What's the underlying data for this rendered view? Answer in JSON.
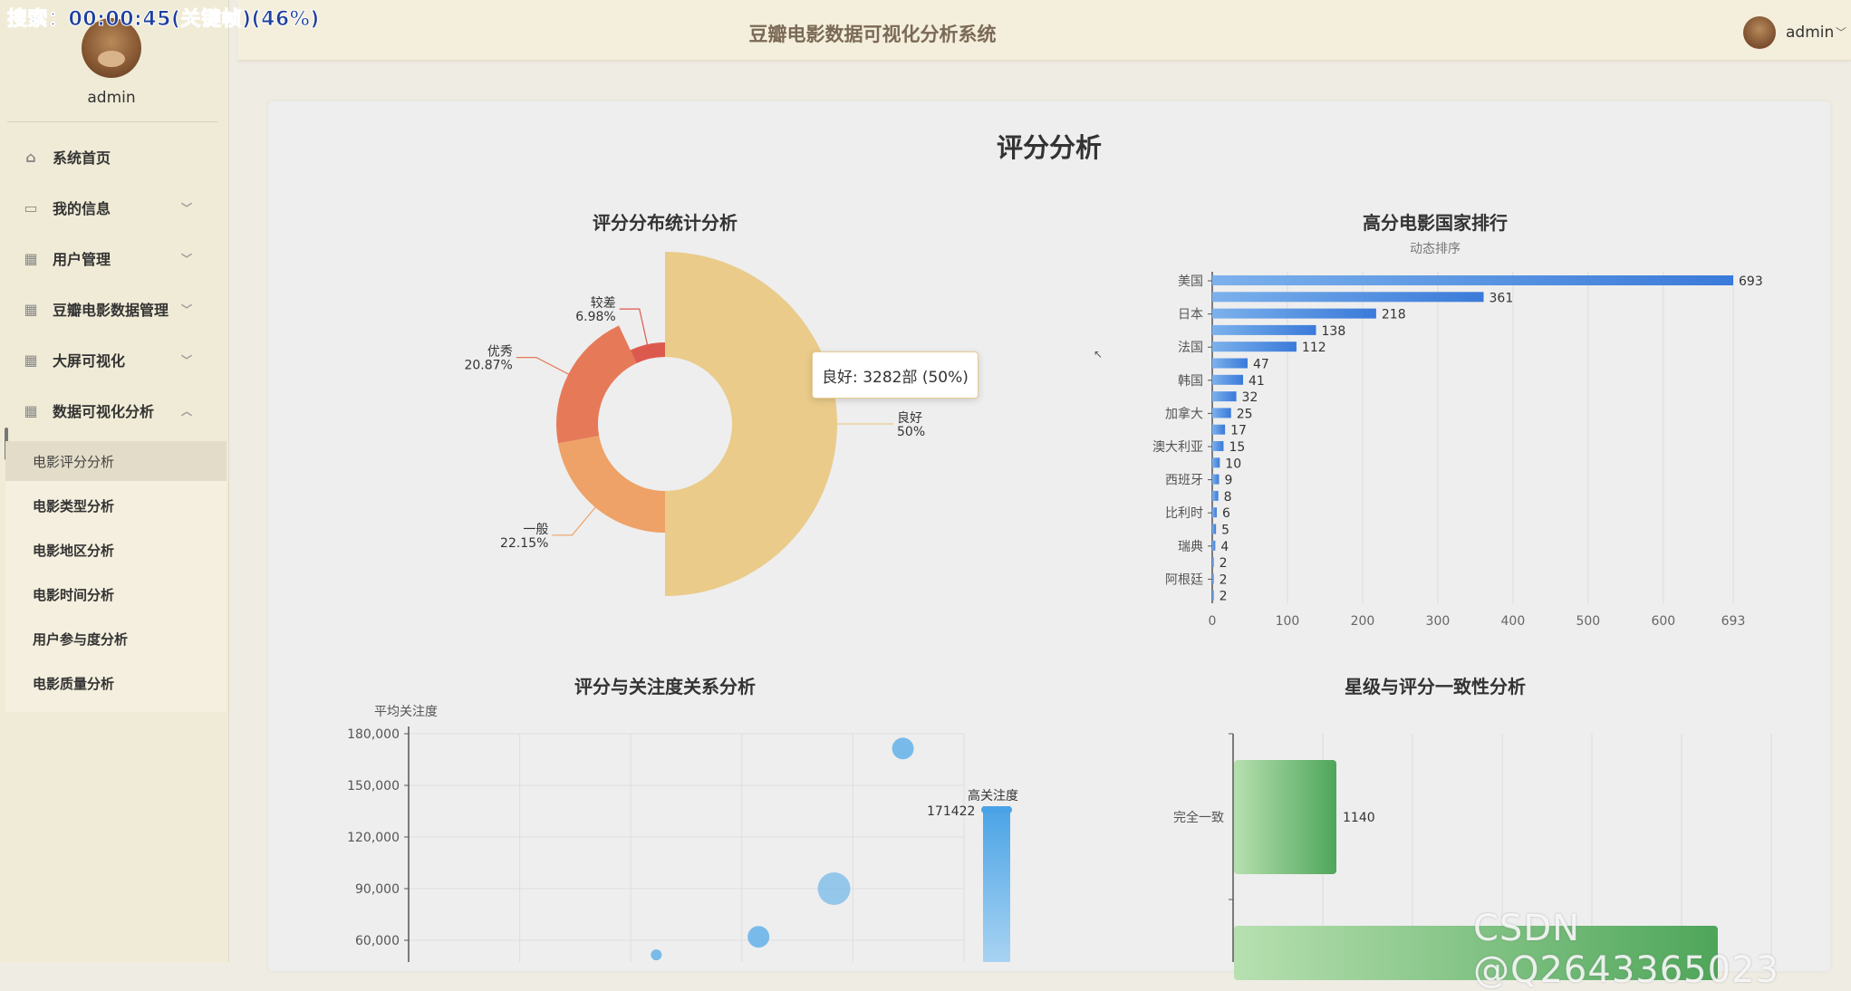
{
  "overlay": {
    "text": "搜索：00:00:45(关键帧)(46%)"
  },
  "header": {
    "title": "豆瓣电影数据可视化分析系统",
    "username": "admin"
  },
  "sidebar": {
    "username": "admin",
    "menu": [
      {
        "label": "系统首页",
        "icon": "home-icon"
      },
      {
        "label": "我的信息",
        "icon": "card-icon"
      },
      {
        "label": "用户管理",
        "icon": "grid-icon"
      },
      {
        "label": "豆瓣电影数据管理",
        "icon": "grid-icon"
      },
      {
        "label": "大屏可视化",
        "icon": "grid-icon"
      },
      {
        "label": "数据可视化分析",
        "icon": "grid-icon"
      }
    ],
    "submenu": [
      "电影评分分析",
      "电影类型分析",
      "电影地区分析",
      "电影时间分析",
      "用户参与度分析",
      "电影质量分析"
    ]
  },
  "page": {
    "title": "评分分析"
  },
  "charts": {
    "pie": {
      "title": "评分分布统计分析",
      "tooltip": "良好: 3282部 (50%)"
    },
    "bar": {
      "title": "高分电影国家排行",
      "subtitle": "动态排序"
    },
    "scatter": {
      "title": "评分与关注度关系分析",
      "y_axis_name": "平均关注度",
      "visual_map_label": "高关注度",
      "visual_map_max": "171422"
    },
    "hbar": {
      "title": "星级与评分一致性分析"
    }
  },
  "watermark": "CSDN @Q2643365023",
  "chart_data": [
    {
      "type": "pie",
      "title": "评分分布统计分析",
      "slices": [
        {
          "name": "良好",
          "label": "50%",
          "value": 50,
          "color": "#eacb8a"
        },
        {
          "name": "一般",
          "label": "22.15%",
          "value": 22.15,
          "color": "#eea267"
        },
        {
          "name": "优秀",
          "label": "20.87%",
          "value": 20.87,
          "color": "#e67a58"
        },
        {
          "name": "较差",
          "label": "6.98%",
          "value": 6.98,
          "color": "#dc5a4d"
        }
      ]
    },
    {
      "type": "bar",
      "title": "高分电影国家排行",
      "subtitle": "动态排序",
      "values": [
        693,
        361,
        218,
        138,
        112,
        47,
        41,
        32,
        25,
        17,
        15,
        10,
        9,
        8,
        6,
        5,
        4,
        2,
        2,
        2
      ],
      "category_labels": [
        "美国",
        "日本",
        "法国",
        "韩国",
        "加拿大",
        "澳大利亚",
        "西班牙",
        "比利时",
        "瑞典",
        "阿根廷"
      ],
      "label_rows": [
        0,
        2,
        4,
        6,
        8,
        10,
        12,
        14,
        16,
        18
      ],
      "xticks": [
        "0",
        "100",
        "200",
        "300",
        "400",
        "500",
        "600",
        "693"
      ],
      "xtick_values": [
        0,
        100,
        200,
        300,
        400,
        500,
        600,
        693
      ],
      "xlim": [
        0,
        693
      ]
    },
    {
      "type": "scatter",
      "title": "评分与关注度关系分析",
      "ylabel": "平均关注度",
      "yticks": [
        "60,000",
        "90,000",
        "120,000",
        "150,000",
        "180,000"
      ],
      "ytick_values": [
        60000,
        90000,
        120000,
        150000,
        180000
      ],
      "points": [
        {
          "xi": 4.45,
          "y": 171422,
          "r": 12
        },
        {
          "xi": 3.83,
          "y": 90000,
          "r": 18
        },
        {
          "xi": 3.15,
          "y": 62000,
          "r": 12
        },
        {
          "xi": 2.23,
          "y": 51500,
          "r": 6
        }
      ],
      "x_grid_count": 5
    },
    {
      "type": "bar",
      "title": "星级与评分一致性分析",
      "categories": [
        "完全一致"
      ],
      "values": [
        1140
      ]
    }
  ]
}
